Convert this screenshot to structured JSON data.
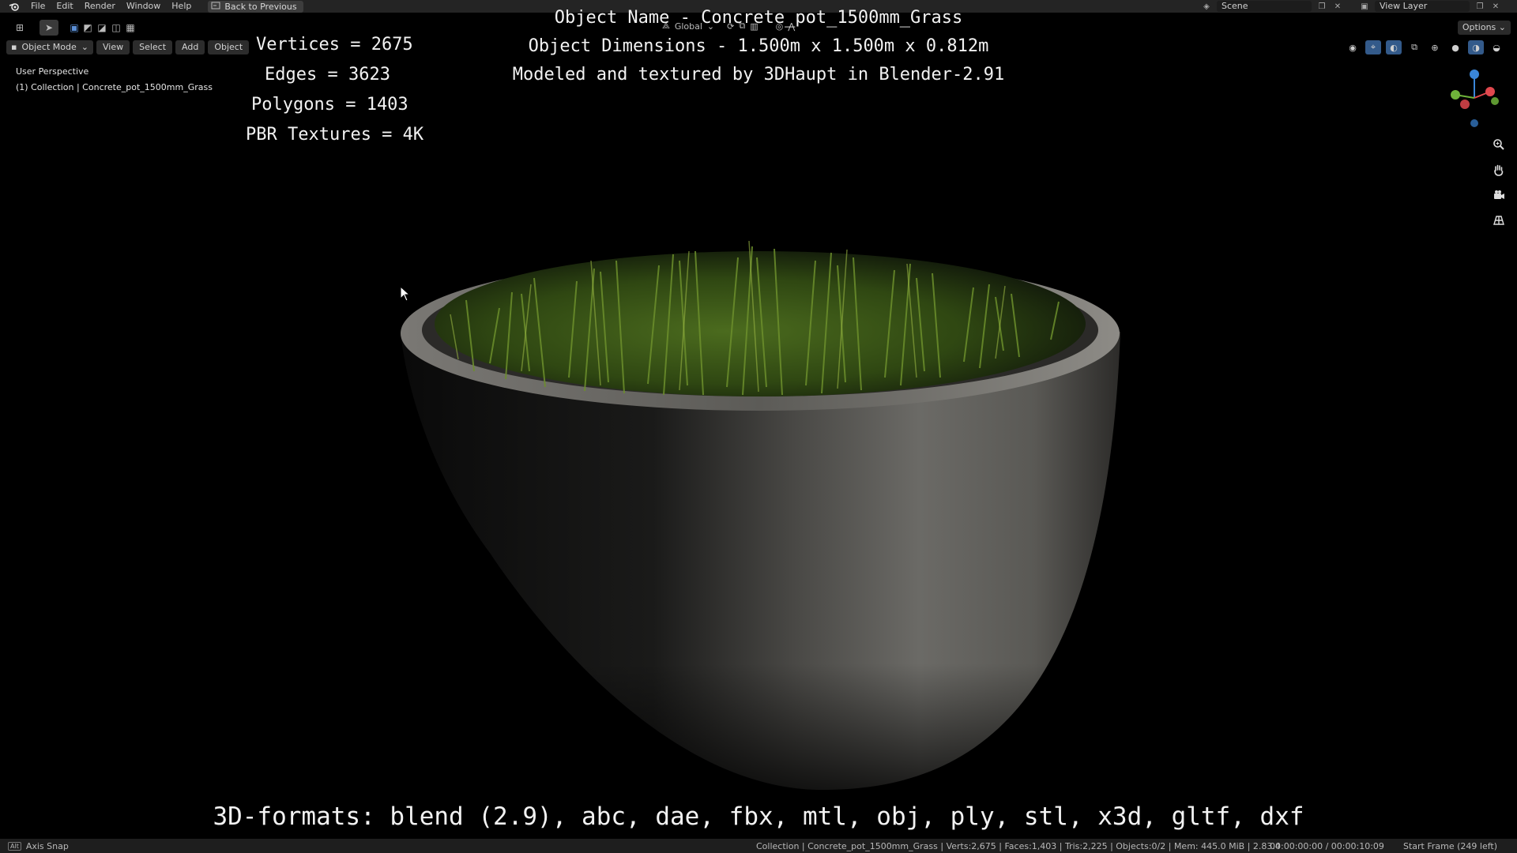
{
  "topbar": {
    "menus": [
      "File",
      "Edit",
      "Render",
      "Window",
      "Help"
    ],
    "back_label": "Back to Previous",
    "scene_label": "Scene",
    "view_layer_label": "View Layer"
  },
  "toolbar": {
    "orientation": "Global",
    "options_label": "Options"
  },
  "viewport_header": {
    "mode": "Object Mode",
    "menus": [
      "View",
      "Select",
      "Add",
      "Object"
    ]
  },
  "viewport": {
    "perspective": "User Perspective",
    "collection": "(1) Collection | Concrete_pot_1500mm_Grass"
  },
  "overlay": {
    "title": "Object Name - Concrete_pot_1500mm_Grass",
    "stats": [
      "Vertices = 2675",
      "Edges = 3623",
      "Polygons = 1403",
      "PBR Textures = 4K"
    ],
    "dimensions": "Object Dimensions -  1.500m x 1.500m x 0.812m",
    "credit": "Modeled and textured by 3DHaupt in Blender-2.91",
    "formats": "3D-formats: blend (2.9), abc, dae, fbx, mtl, obj, ply, stl, x3d, gltf, dxf"
  },
  "statusbar": {
    "axis_snap": "Axis Snap",
    "stats": "Collection | Concrete_pot_1500mm_Grass | Verts:2,675 | Faces:1,403 | Tris:2,225 | Objects:0/2 | Mem: 445.0 MiB | 2.83.4",
    "time": "00:00:00:00 / 00:00:10:09",
    "frame": "Start Frame (249 left)"
  },
  "icons": {
    "logo": "blender-logo-icon",
    "nav": [
      "zoom-icon",
      "hand-pan-icon",
      "camera-icon",
      "grid-icon"
    ]
  },
  "colors": {
    "x_axis": "#e0484e",
    "y_axis": "#6fb33a",
    "z_axis": "#3a86d8",
    "ui_bar": "#242424"
  }
}
